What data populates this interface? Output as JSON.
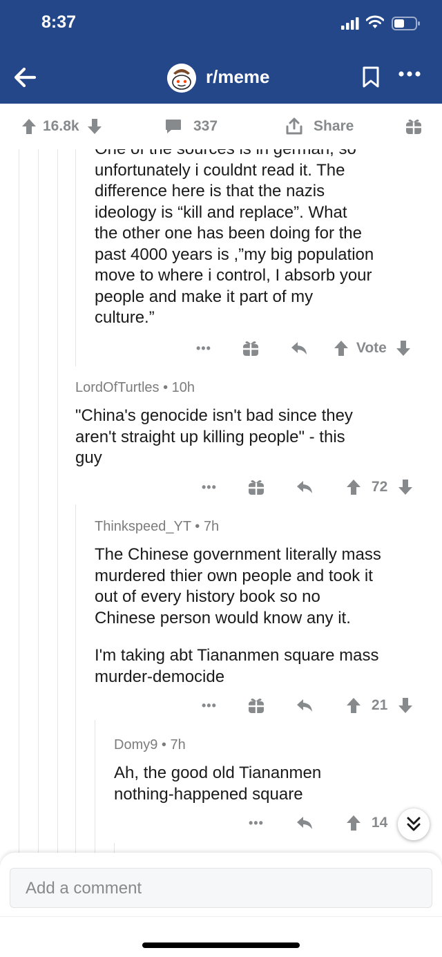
{
  "status_bar": {
    "time": "8:37"
  },
  "header": {
    "subreddit": "r/meme"
  },
  "post_actions": {
    "score": "16.8k",
    "comments": "337",
    "share_label": "Share"
  },
  "comments": [
    {
      "text_lines": [
        "One of the sources is in german, so",
        "unfortunately i couldnt read it. The",
        "difference here is that the nazis",
        "ideology is “kill and replace”. What",
        "the other one has been doing for the",
        "past 4000 years is ,”my big population",
        "move to where i control, I absorb your",
        "people and make it part of my",
        "culture.”"
      ],
      "score": "Vote"
    },
    {
      "author": "LordOfTurtles",
      "age": "10h",
      "text_lines": [
        "\"China's genocide isn't bad since they",
        "aren't straight up killing people\" - this",
        "guy"
      ],
      "score": "72"
    },
    {
      "author": "Thinkspeed_YT",
      "age": "7h",
      "text_lines": [
        "The Chinese government literally mass",
        "murdered thier own people and took it",
        "out of every history book so no",
        "Chinese person would know any it.",
        "",
        "I'm taking abt Tiananmen square mass",
        "murder-democide"
      ],
      "score": "21"
    },
    {
      "author": "Domy9",
      "age": "7h",
      "text_lines": [
        "Ah, the good old Tiananmen",
        "nothing-happened square"
      ],
      "score": "14"
    }
  ],
  "composer": {
    "placeholder": "Add a comment"
  },
  "icons": {
    "back": "arrow-left-icon",
    "bookmark": "bookmark-icon",
    "more": "more-dots-icon",
    "upvote": "arrow-up-icon",
    "downvote": "arrow-down-icon",
    "comment": "speech-bubble-icon",
    "share": "share-icon",
    "award": "gift-icon",
    "reply": "reply-icon",
    "scroll": "double-chevron-down-icon"
  },
  "colors": {
    "header_bg": "#24478a",
    "meta_gray": "#878a8c",
    "text": "#1a1a1b"
  }
}
